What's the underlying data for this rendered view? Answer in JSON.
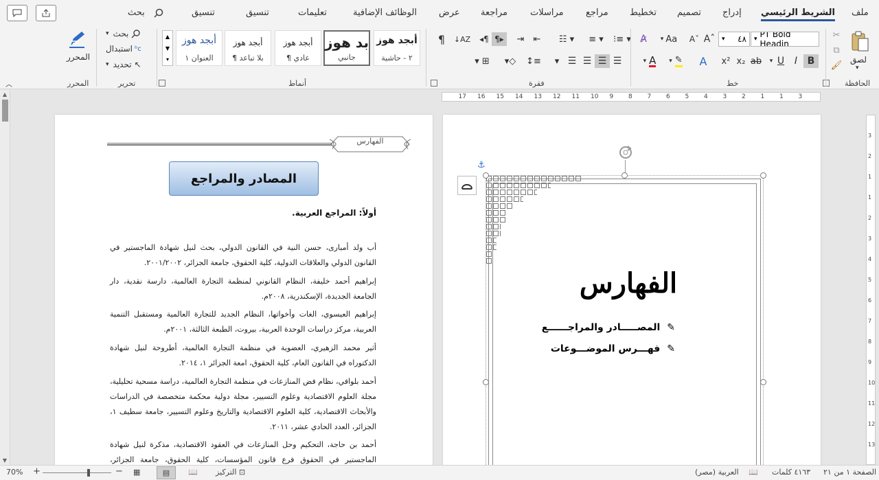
{
  "tabs": {
    "file": "ملف",
    "home": "الشريط الرئيسي",
    "insert": "إدراج",
    "design": "تصميم",
    "layout": "تخطيط",
    "references": "مراجع",
    "mailings": "مراسلات",
    "review": "مراجعة",
    "view": "عرض",
    "addins": "الوظائف الإضافية",
    "help": "تعليمات",
    "format1": "تنسيق",
    "format2": "تنسيق",
    "search": "بحث"
  },
  "ribbon": {
    "clipboard": {
      "label": "الحافظة",
      "paste": "لصق"
    },
    "font": {
      "label": "خط",
      "font_name": "PT Bold Headin",
      "font_size": "٤٨",
      "aa": "Aa"
    },
    "paragraph": {
      "label": "فقرة"
    },
    "styles": {
      "label": "أنماط",
      "cards": [
        {
          "sample": "أبجد هوز",
          "name": "٢ - حاشية"
        },
        {
          "sample": "بد هوز",
          "name": "جانبي"
        },
        {
          "sample": "أبجد هوز",
          "name": "¶ عادي"
        },
        {
          "sample": "أبجد هوز",
          "name": "¶ بلا تباعد"
        },
        {
          "sample": "أبجد هوز",
          "name": "العنوان ١"
        }
      ]
    },
    "editing": {
      "label": "تحرير",
      "find": "بحث",
      "replace": "استبدال",
      "select": "تحديد"
    },
    "editor": {
      "label": "المحرر",
      "button": "المحرر"
    }
  },
  "ruler": {
    "labels": [
      "3",
      "1",
      "1",
      "2",
      "3",
      "4",
      "5",
      "6",
      "7",
      "8",
      "9",
      "10",
      "11",
      "12",
      "13",
      "14",
      "15",
      "16",
      "17"
    ]
  },
  "vruler": {
    "labels": [
      "3",
      "2",
      "1",
      "1",
      "2",
      "3",
      "4",
      "5",
      "6",
      "7",
      "8",
      "9",
      "10",
      "11",
      "12",
      "13"
    ]
  },
  "right_page": {
    "title": "الفهارس",
    "items": [
      "المصـــــادر والمراجــــــع",
      "فهـــرس الموضـــوعات"
    ]
  },
  "left_page": {
    "header_banner": "الفهارس",
    "box_title": "المصادر والمراجع",
    "section_heading": "أولاً: المراجع العربية.",
    "refs": [
      "أب ولد أمبارى، حسن النية في القانون الدولي، بحث لنيل شهادة الماجستير في القانون الدولي والعلاقات الدولية، كلية الحقوق، جامعة الجزائر، ٢٠٠١/٢٠٠٢.",
      "إبراهيم أحمد خليفة، النظام القانوني لمنظمة التجارة العالمية، دارسة نقدية، دار الجامعة الجديدة، الإسكندرية، ٢٠٠٨م.",
      "إبراهيم العيسوي، الغات وأخواتها، النظام الجديد للتجارة العالمية ومستقبل التنمية العربية، مركز دراسات الوحدة العربية، بيروت، الطبعة الثالثة، ٢٠٠١م.",
      "أثير محمد الزهيري، العضوية في منظمة التجارة العالمية، أطروحة لنيل شهادة الدكتوراه في القانون العام، كلية الحقوق، امعة الجزائر ١، ٢٠١٤.",
      "أحمد بلوافي، نظام فض المنازعات في منظمة التجارة العالمية، دراسة مسحية تحليلية، مجلة العلوم الاقتصادية وعلوم التسيير، مجلة دولية محكمة متخصصة في الدراسات والأبحاث الاقتصادية، كلية العلوم الاقتصادية والتاريخ وعلوم التسيير، جامعة سطيف ١، الجزائر، العدد الحادي عشر، ٢٠١١.",
      "أحمد بن حاجة، التحكيم وحل المنازعات في العقود الاقتصادية، مذكرة لنيل شهادة الماجستير في الحقوق فرع قانون المؤسسات، كلية الحقوق، جامعة الجزائر، ٢٠٠٥/٢٠٠٦."
    ]
  },
  "status": {
    "page": "الصفحة ١ من ٢١",
    "words": "٤١٦٣ كلمات",
    "language": "العربية (مصر)",
    "focus": "التركيز",
    "zoom": "70%",
    "zoom_level": 0.7
  }
}
